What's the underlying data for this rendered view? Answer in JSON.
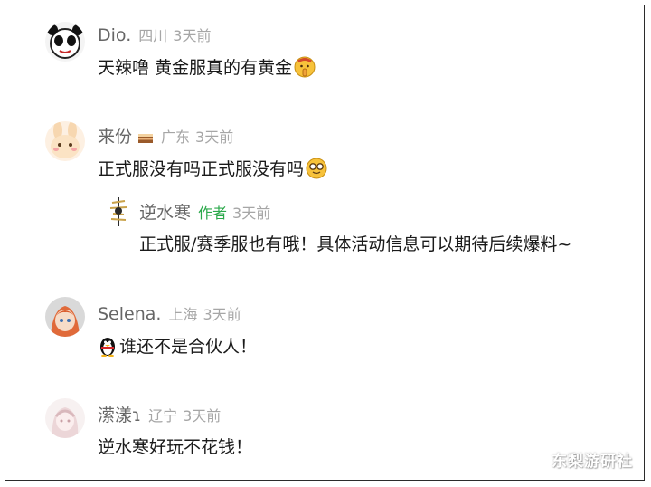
{
  "comments": [
    {
      "user": "Dio.",
      "location": "四川",
      "time": "3天前",
      "text": "天辣噜 黄金服真的有黄金",
      "emoji": "shush-face-emoji"
    },
    {
      "user": "来份",
      "location": "广东",
      "time": "3天前",
      "text": "正式服没有吗正式服没有吗",
      "emoji": "nerd-face-emoji",
      "reply": {
        "user": "逆水寒",
        "badge": "作者",
        "time": "3天前",
        "text": "正式服/赛季服也有哦！具体活动信息可以期待后续爆料~"
      }
    },
    {
      "user": "Selena.",
      "location": "上海",
      "time": "3天前",
      "text": "谁还不是合伙人！",
      "emoji": "penguin-emoji"
    },
    {
      "user": "潆漾ɿ",
      "location": "辽宁",
      "time": "3天前",
      "text": "逆水寒好玩不花钱！"
    }
  ],
  "watermark": "东梨游研社",
  "colors": {
    "username": "#666666",
    "meta": "#a6a6a6",
    "author_badge": "#2aa84a",
    "text": "#1a1a1a"
  }
}
